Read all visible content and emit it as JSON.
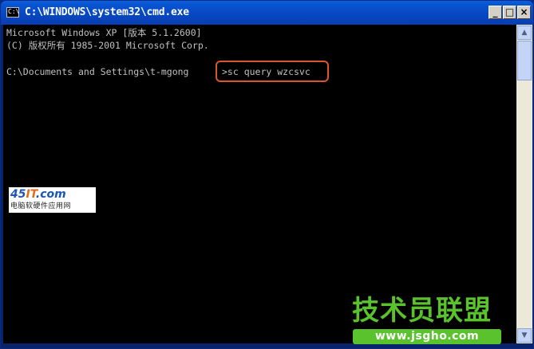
{
  "window": {
    "title": "C:\\WINDOWS\\system32\\cmd.exe",
    "icon_glyph": "C:\\",
    "controls": {
      "minimize": "_",
      "maximize": "□",
      "close": "×"
    }
  },
  "console": {
    "lines": [
      "Microsoft Windows XP [版本 5.1.2600]",
      "(C) 版权所有 1985-2001 Microsoft Corp.",
      "C:\\Documents and Settings\\t-mgong"
    ],
    "command": ">sc query wzcsvc",
    "text_color": "#c0c0c0",
    "background": "#000000",
    "highlight_color": "#d9562e"
  },
  "scrollbar": {
    "up_icon": "▲",
    "down_icon": "▼"
  },
  "watermark": {
    "logo_45": "45",
    "logo_it": "IT",
    "logo_com": ".com",
    "logo_subtitle": "电脑软硬件应用网",
    "site_title": "技术员联盟",
    "site_url": "www.jsgho.com",
    "accent": "#59c22c"
  }
}
